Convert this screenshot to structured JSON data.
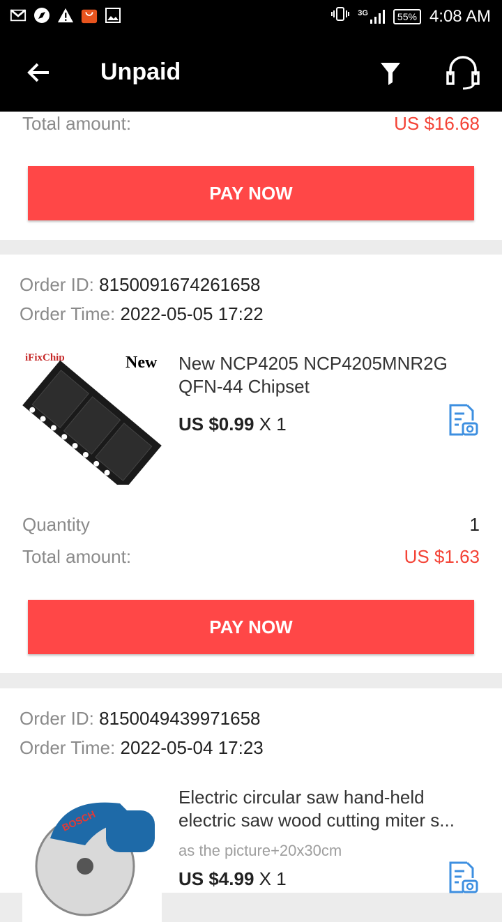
{
  "status_bar": {
    "network": "3G",
    "battery": "55%",
    "time": "4:08 AM"
  },
  "app_bar": {
    "title": "Unpaid"
  },
  "top_card": {
    "total_label": "Total amount:",
    "total_value": "US $16.68",
    "pay_label": "PAY NOW"
  },
  "orders": [
    {
      "id_label": "Order ID:",
      "id": "8150091674261658",
      "time_label": "Order Time:",
      "time": "2022-05-05 17:22",
      "product_name_line1": "New NCP4205 NCP4205MNR2G",
      "product_name_line2": "QFN-44 Chipset",
      "price": "US $0.99",
      "qty": "X 1",
      "quantity_label": "Quantity",
      "quantity_value": "1",
      "total_label": "Total amount:",
      "total_value": "US $1.63",
      "pay_label": "PAY NOW",
      "thumb_brand": "iFixChip",
      "thumb_tag": "New"
    },
    {
      "id_label": "Order ID:",
      "id": "8150049439971658",
      "time_label": "Order Time:",
      "time": "2022-05-04 17:23",
      "product_name_line1": "Electric circular saw hand-held",
      "product_name_line2": "electric saw wood cutting miter s...",
      "variant": "as the picture+20x30cm",
      "price": "US $4.99",
      "qty": "X 1",
      "thumb_brand": "BOSCH"
    }
  ]
}
